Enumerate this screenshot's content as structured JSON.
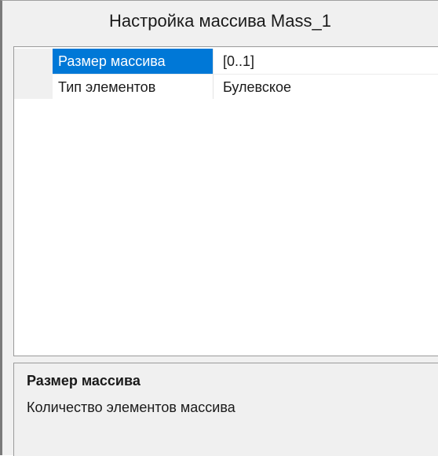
{
  "title": "Настройка массива Mass_1",
  "properties": [
    {
      "name": "Размер массива",
      "value": "[0..1]",
      "selected": true
    },
    {
      "name": "Тип элементов",
      "value": "Булевское",
      "selected": false
    }
  ],
  "description": {
    "title": "Размер массива",
    "text": "Количество элементов массива"
  },
  "colors": {
    "selection": "#0078d7",
    "panel_background": "#f0f0f0",
    "grid_background": "#ffffff"
  }
}
